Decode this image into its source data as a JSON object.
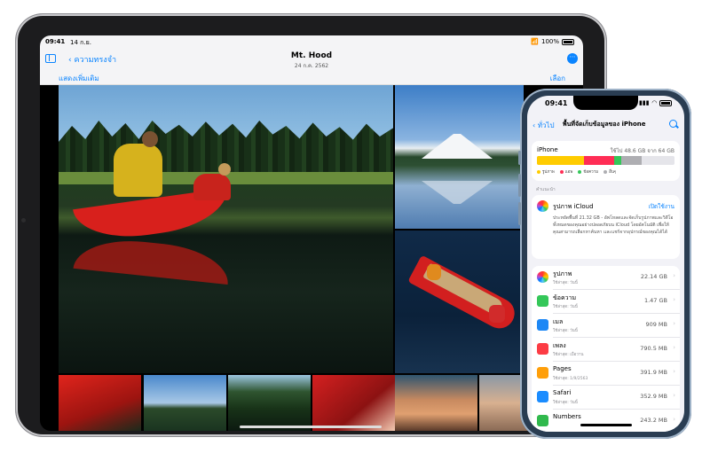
{
  "ipad": {
    "status": {
      "time": "09:41",
      "date": "14 ก.ย.",
      "battery": "100%"
    },
    "nav": {
      "back_label": "ความทรงจำ",
      "title": "Mt. Hood",
      "subtitle": "24 ก.ค. 2562",
      "more_label": "⋯"
    },
    "toolbar": {
      "show_more_label": "แสดงเพิ่มเติม",
      "select_label": "เลือก"
    }
  },
  "iphone": {
    "status": {
      "time": "09:41"
    },
    "nav": {
      "back_label": "ทั่วไป",
      "title": "พื้นที่จัดเก็บข้อมูลของ iPhone"
    },
    "storage": {
      "device_label": "iPhone",
      "used_label": "ใช้ไป 48.6 GB จาก 64 GB",
      "used_fraction": 0.76,
      "segments": [
        {
          "category": "photos",
          "fraction": 0.34,
          "color": "#ffcc00"
        },
        {
          "category": "apps",
          "fraction": 0.22,
          "color": "#ff2d55"
        },
        {
          "category": "messages",
          "fraction": 0.05,
          "color": "#34c759"
        },
        {
          "category": "other",
          "fraction": 0.15,
          "color": "#aeaeb2"
        }
      ],
      "legend": [
        {
          "label": "รูปภาพ",
          "color": "#ffcc00"
        },
        {
          "label": "แอพ",
          "color": "#ff2d55"
        },
        {
          "label": "ข้อความ",
          "color": "#34c759"
        },
        {
          "label": "อื่นๆ",
          "color": "#aeaeb2"
        }
      ]
    },
    "recommendation": {
      "section_label": "คำแนะนำ",
      "name": "รูปภาพ iCloud",
      "enable_label": "เปิดใช้งาน",
      "description": "ประหยัดพื้นที่ 21.32 GB - อัพโหลดและจัดเก็บรูปภาพและวิดีโอทั้งหมดของคุณอย่างปลอดภัยบน iCloud โดยอัตโนมัติ เพื่อให้คุณสามารถเลือกหาค้นหา และแชร์จากอุปกรณ์ของคุณได้ได้"
    },
    "apps": [
      {
        "name": "รูปภาพ",
        "sub": "ใช้ล่าสุด: วันนี้",
        "size": "22.14 GB",
        "icon": "photos-icon",
        "color": "#ffffff"
      },
      {
        "name": "ข้อความ",
        "sub": "ใช้ล่าสุด: วันนี้",
        "size": "1.47 GB",
        "icon": "messages-icon",
        "color": "#34c759"
      },
      {
        "name": "เมล",
        "sub": "ใช้ล่าสุด: วันนี้",
        "size": "909 MB",
        "icon": "mail-icon",
        "color": "#1e88f5"
      },
      {
        "name": "เพลง",
        "sub": "ใช้ล่าสุด: เมื่อวาน",
        "size": "790.5 MB",
        "icon": "music-icon",
        "color": "#fc3c44"
      },
      {
        "name": "Pages",
        "sub": "ใช้ล่าสุด: 1/9/2563",
        "size": "391.9 MB",
        "icon": "pages-icon",
        "color": "#ff9f0a"
      },
      {
        "name": "Safari",
        "sub": "ใช้ล่าสุด: วันนี้",
        "size": "352.9 MB",
        "icon": "safari-icon",
        "color": "#1a8cff"
      },
      {
        "name": "Numbers",
        "sub": "",
        "size": "243.2 MB",
        "icon": "numbers-icon",
        "color": "#30b94d"
      }
    ]
  }
}
